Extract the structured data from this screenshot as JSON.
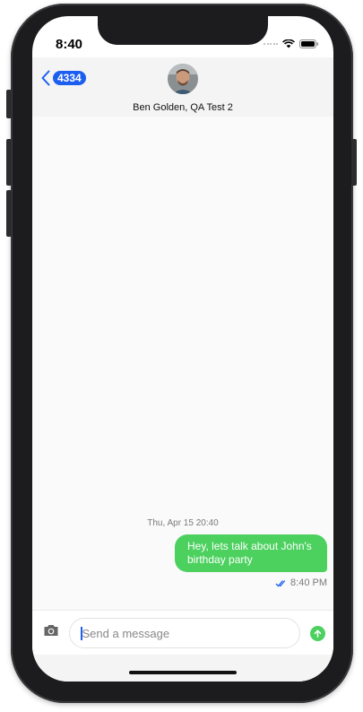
{
  "status_bar": {
    "time": "8:40"
  },
  "header": {
    "back_badge": "4334",
    "contact_name": "Ben Golden, QA Test 2"
  },
  "chat": {
    "date_separator": "Thu, Apr 15 20:40",
    "messages": [
      {
        "text": "Hey, lets talk about John's birthday party",
        "time": "8:40 PM",
        "status_icon": "double-check-icon"
      }
    ]
  },
  "composer": {
    "placeholder": "Send a message"
  },
  "colors": {
    "accent": "#1c5ff0",
    "bubble": "#4cd15f"
  }
}
